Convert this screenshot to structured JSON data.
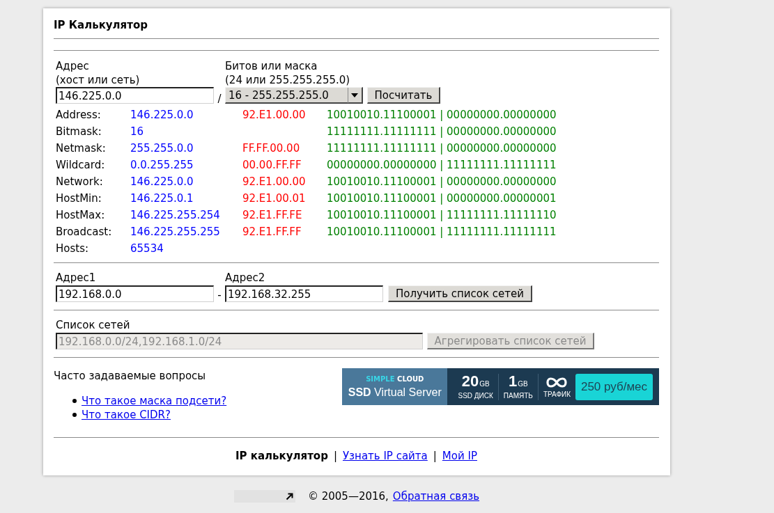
{
  "window": {
    "title": "IP Калькулятор"
  },
  "calculator": {
    "address": {
      "label": "Адрес",
      "hint": "(хост или сеть)",
      "value": "146.225.0.0"
    },
    "separator": "/",
    "mask": {
      "label": "Битов или маска",
      "hint": "(24 или 255.255.255.0)",
      "value": "16 - 255.255.255.0"
    },
    "button": "Посчитать"
  },
  "results": [
    {
      "label": "Address:",
      "decimal": "146.225.0.0",
      "hex": "92.E1.00.00",
      "binary": "10010010.11100001 | 00000000.00000000"
    },
    {
      "label": "Bitmask:",
      "decimal": "16",
      "binary": "11111111.11111111 | 00000000.00000000"
    },
    {
      "label": "Netmask:",
      "decimal": "255.255.0.0",
      "hex": "FF.FF.00.00",
      "binary": "11111111.11111111 | 00000000.00000000"
    },
    {
      "label": "Wildcard:",
      "decimal": "0.0.255.255",
      "hex": "00.00.FF.FF",
      "binary": "00000000.00000000 | 11111111.11111111"
    },
    {
      "label": "Network:",
      "decimal": "146.225.0.0",
      "hex": "92.E1.00.00",
      "binary": "10010010.11100001 | 00000000.00000000"
    },
    {
      "label": "HostMin:",
      "decimal": "146.225.0.1",
      "hex": "92.E1.00.01",
      "binary": "10010010.11100001 | 00000000.00000001"
    },
    {
      "label": "HostMax:",
      "decimal": "146.225.255.254",
      "hex": "92.E1.FF.FE",
      "binary": "10010010.11100001 | 11111111.11111110"
    },
    {
      "label": "Broadcast:",
      "decimal": "146.225.255.255",
      "hex": "92.E1.FF.FF",
      "binary": "10010010.11100001 | 11111111.11111111"
    },
    {
      "label": "Hosts:",
      "decimal": "65534"
    }
  ],
  "range": {
    "address1": {
      "label": "Адрес1",
      "value": "192.168.0.0"
    },
    "separator": "-",
    "address2": {
      "label": "Адрес2",
      "value": "192.168.32.255"
    },
    "button": "Получить список сетей"
  },
  "networks": {
    "label": "Список сетей",
    "value": "192.168.0.0/24,192.168.1.0/24",
    "disabled": true,
    "button": {
      "label": "Агрегировать список сетей",
      "disabled": true
    }
  },
  "faq": {
    "title": "Часто задаваемые вопросы",
    "links": [
      "Что такое маска подсети?",
      "Что такое CIDR?"
    ]
  },
  "banner": {
    "brand": [
      {
        "kind": "accent",
        "text": "SIMPLE"
      },
      {
        "kind": "plain",
        "text": "CLOUD"
      }
    ],
    "product": "**SSD** Virtual Server",
    "specs": [
      {
        "kind": "amount",
        "value": "20",
        "unit": "GB",
        "label": "SSD ДИСК"
      },
      {
        "kind": "amount",
        "value": "1",
        "unit": "GB",
        "label": "ПАМЯТЬ"
      },
      {
        "kind": "unlimited",
        "label": "ТРАФИК"
      }
    ],
    "price": "250 руб/мес"
  },
  "footer": {
    "nav": [
      {
        "text": "IP калькулятор",
        "selected": true
      },
      {
        "text": "Узнать IP сайта",
        "selected": false
      },
      {
        "text": "Мой IP",
        "selected": false
      }
    ],
    "separators": [
      "|",
      "|"
    ]
  },
  "copyright": {
    "text": "© 2005—2016,",
    "link": "Обратная связь"
  }
}
